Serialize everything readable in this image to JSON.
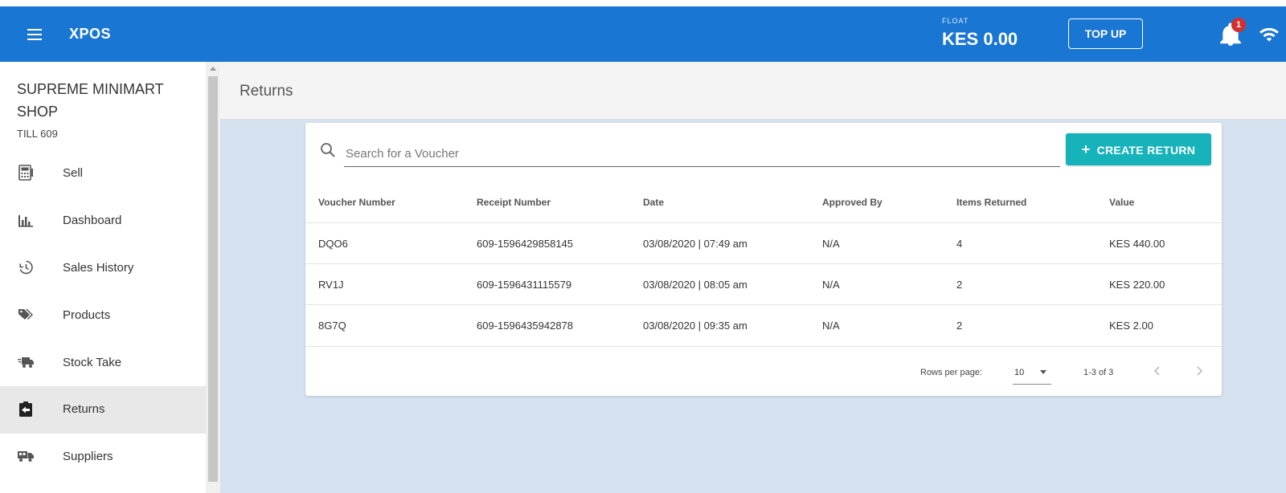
{
  "topbar": {
    "app_title": "XPOS",
    "float_label": "FLOAT",
    "float_value": "KES 0.00",
    "topup_label": "TOP UP",
    "notification_count": "1"
  },
  "sidebar": {
    "shop_name": "SUPREME MINIMART SHOP",
    "till": "TILL 609",
    "items": [
      {
        "label": "Sell",
        "icon": "register-icon"
      },
      {
        "label": "Dashboard",
        "icon": "bar-chart-icon"
      },
      {
        "label": "Sales History",
        "icon": "history-icon"
      },
      {
        "label": "Products",
        "icon": "tags-icon"
      },
      {
        "label": "Stock Take",
        "icon": "truck-icon"
      },
      {
        "label": "Returns",
        "icon": "clipboard-return-icon"
      },
      {
        "label": "Suppliers",
        "icon": "supplier-truck-icon"
      }
    ],
    "active_item": "Returns"
  },
  "main": {
    "page_title": "Returns",
    "search_placeholder": "Search for a Voucher",
    "create_label": "CREATE RETURN",
    "table": {
      "headers": [
        "Voucher Number",
        "Receipt Number",
        "Date",
        "Approved By",
        "Items Returned",
        "Value"
      ],
      "rows": [
        [
          "DQO6",
          "609-1596429858145",
          "03/08/2020 | 07:49 am",
          "N/A",
          "4",
          "KES 440.00"
        ],
        [
          "RV1J",
          "609-1596431115579",
          "03/08/2020 | 08:05 am",
          "N/A",
          "2",
          "KES 220.00"
        ],
        [
          "8G7Q",
          "609-1596435942878",
          "03/08/2020 | 09:35 am",
          "N/A",
          "2",
          "KES 2.00"
        ]
      ]
    },
    "pagination": {
      "rows_per_page_label": "Rows per page:",
      "rows_per_page_value": "10",
      "range": "1-3 of 3"
    }
  },
  "colors": {
    "topbar": "#1976d2",
    "accent": "#17b3bb",
    "badge": "#d32f2f",
    "content_bg": "#d6e2f0"
  }
}
